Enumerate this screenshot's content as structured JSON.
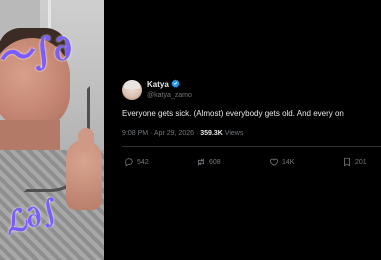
{
  "tweet": {
    "display_name": "Katya",
    "handle": "@katya_zamo",
    "text": "Everyone gets sick. (Almost) everybody gets old.  And every on",
    "time": "9:08 PM",
    "date": "Apr 29, 2026",
    "views_count": "359.3K",
    "views_label": "Views",
    "meta_sep": " · ",
    "replies": "542",
    "reposts": "608",
    "likes": "14K",
    "bookmarks": "201"
  },
  "icons": {
    "verified": "verified-badge-icon",
    "reply": "reply-icon",
    "repost": "repost-icon",
    "like": "heart-icon",
    "bookmark": "bookmark-icon"
  },
  "colors": {
    "background": "#000000",
    "text": "#e7e9ea",
    "muted": "#71767b",
    "verified": "#1d9bf0",
    "scribble": "#7a5cff"
  }
}
